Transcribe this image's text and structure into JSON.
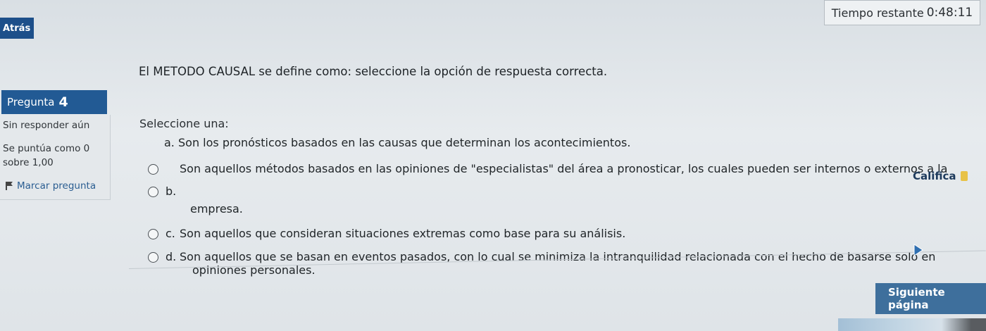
{
  "header": {
    "back_label": "Atrás",
    "timer_label": "Tiempo restante",
    "timer_value": "0:48:11"
  },
  "sidebar": {
    "question_label": "Pregunta",
    "question_number": "4",
    "status": "Sin responder aún",
    "score_line1": "Se puntúa como 0",
    "score_line2": "sobre 1,00",
    "flag_label": "Marcar pregunta"
  },
  "question": {
    "text": "El METODO CAUSAL se define como: seleccione la opción de respuesta correcta.",
    "prompt": "Seleccione una:",
    "options": [
      {
        "letter": "a.",
        "text": "Son los pronósticos basados en las causas que determinan los acontecimientos."
      },
      {
        "letter": "b.",
        "text": "Son aquellos métodos basados en las opiniones de \"especialistas\" del área a pronosticar, los cuales pueden ser internos o externos a la",
        "continuation": "empresa."
      },
      {
        "letter": "c.",
        "text": "Son aquellos que consideran situaciones extremas como base para su análisis."
      },
      {
        "letter": "d.",
        "text": "Son aquellos que se basan en eventos pasados, con lo cual se minimiza la intranquilidad relacionada con el hecho de basarse solo en",
        "continuation": "opiniones personales."
      }
    ]
  },
  "actions": {
    "rate_label": "Califica",
    "next_label": "Siguiente página"
  },
  "icons": {
    "flag": "flag-icon",
    "rate": "rate-icon",
    "cursor": "cursor-arrow-icon"
  }
}
